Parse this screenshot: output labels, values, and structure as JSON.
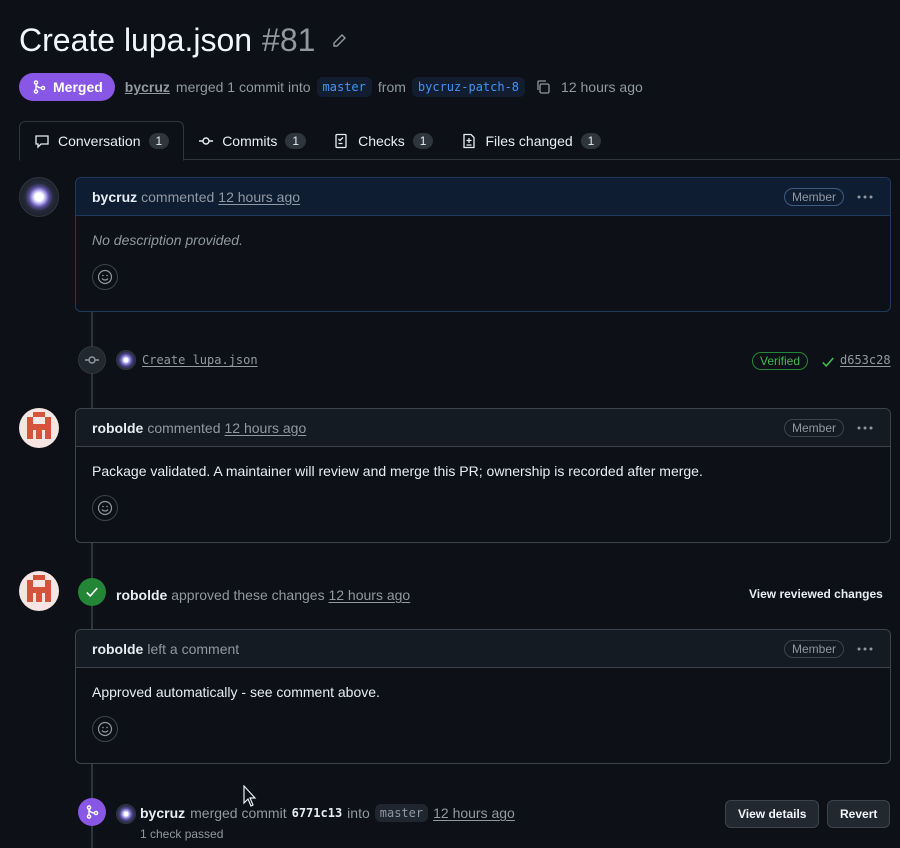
{
  "pr": {
    "title": "Create lupa.json",
    "number": "#81",
    "status": "Merged",
    "author": "bycruz",
    "merge_text": "merged 1 commit into",
    "base_branch": "master",
    "from_text": "from",
    "head_branch": "bycruz-patch-8",
    "time": "12 hours ago"
  },
  "tabs": [
    {
      "label": "Conversation",
      "count": "1"
    },
    {
      "label": "Commits",
      "count": "1"
    },
    {
      "label": "Checks",
      "count": "1"
    },
    {
      "label": "Files changed",
      "count": "1"
    }
  ],
  "comment1": {
    "author": "bycruz",
    "action": "commented",
    "time": "12 hours ago",
    "role": "Member",
    "body": "No description provided."
  },
  "commit": {
    "message": "Create lupa.json",
    "verified": "Verified",
    "sha": "d653c28"
  },
  "comment2": {
    "author": "robolde",
    "action": "commented",
    "time": "12 hours ago",
    "role": "Member",
    "body": "Package validated. A maintainer will review and merge this PR; ownership is recorded after merge."
  },
  "review": {
    "author": "robolde",
    "action": "approved these changes",
    "time": "12 hours ago",
    "view_label": "View reviewed changes"
  },
  "comment3": {
    "author": "robolde",
    "action": "left a comment",
    "role": "Member",
    "body": "Approved automatically - see comment above."
  },
  "merge_event": {
    "author": "bycruz",
    "action": "merged commit",
    "sha": "6771c13",
    "into": "into",
    "branch": "master",
    "time": "12 hours ago",
    "checks": "1 check passed",
    "details_label": "View details",
    "revert_label": "Revert"
  },
  "colors": {
    "merged": "#8957e5",
    "approved": "#238636",
    "background": "#0d1117"
  }
}
